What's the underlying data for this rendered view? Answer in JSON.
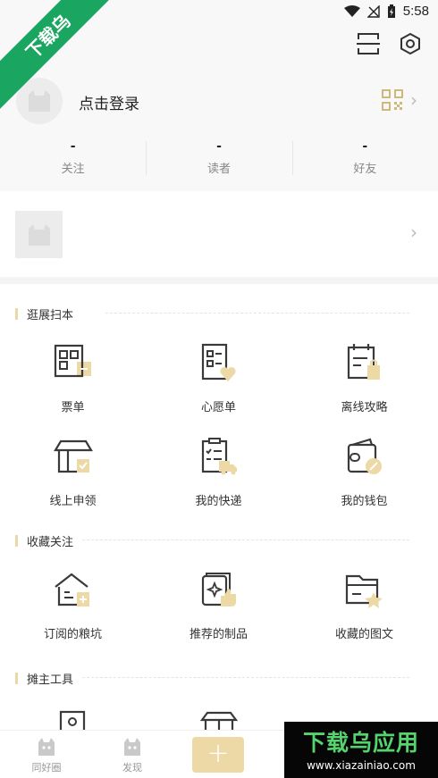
{
  "status_bar": {
    "time": "5:58",
    "icons": [
      "wifi-icon",
      "no-signal-icon",
      "battery-icon"
    ]
  },
  "watermark": {
    "ribbon": "下载乌",
    "brand": "下载乌应用",
    "url": "www.xiazainiao.com"
  },
  "header": {
    "login_text": "点击登录"
  },
  "stats": [
    {
      "value": "-",
      "label": "关注"
    },
    {
      "value": "-",
      "label": "读者"
    },
    {
      "value": "-",
      "label": "好友"
    }
  ],
  "sections": [
    {
      "title": "逛展扫本",
      "items": [
        {
          "label": "票单",
          "icon": "ticket-icon"
        },
        {
          "label": "心愿单",
          "icon": "wishlist-icon"
        },
        {
          "label": "离线攻略",
          "icon": "offline-guide-icon"
        },
        {
          "label": "线上申领",
          "icon": "online-claim-icon"
        },
        {
          "label": "我的快递",
          "icon": "delivery-icon"
        },
        {
          "label": "我的钱包",
          "icon": "wallet-icon"
        }
      ]
    },
    {
      "title": "收藏关注",
      "items": [
        {
          "label": "订阅的粮坑",
          "icon": "subscribe-icon"
        },
        {
          "label": "推荐的制品",
          "icon": "recommend-icon"
        },
        {
          "label": "收藏的图文",
          "icon": "favorite-folder-icon"
        }
      ]
    },
    {
      "title": "摊主工具",
      "items": []
    }
  ],
  "bottom_nav": [
    {
      "label": "同好圈",
      "icon": "circle-icon"
    },
    {
      "label": "发现",
      "icon": "discover-icon"
    },
    {
      "label": "+",
      "icon": "plus-icon"
    }
  ],
  "colors": {
    "accent": "#e9d9a8",
    "icon_line": "#3a3a3a",
    "bg_top": "#f8f8f9"
  }
}
